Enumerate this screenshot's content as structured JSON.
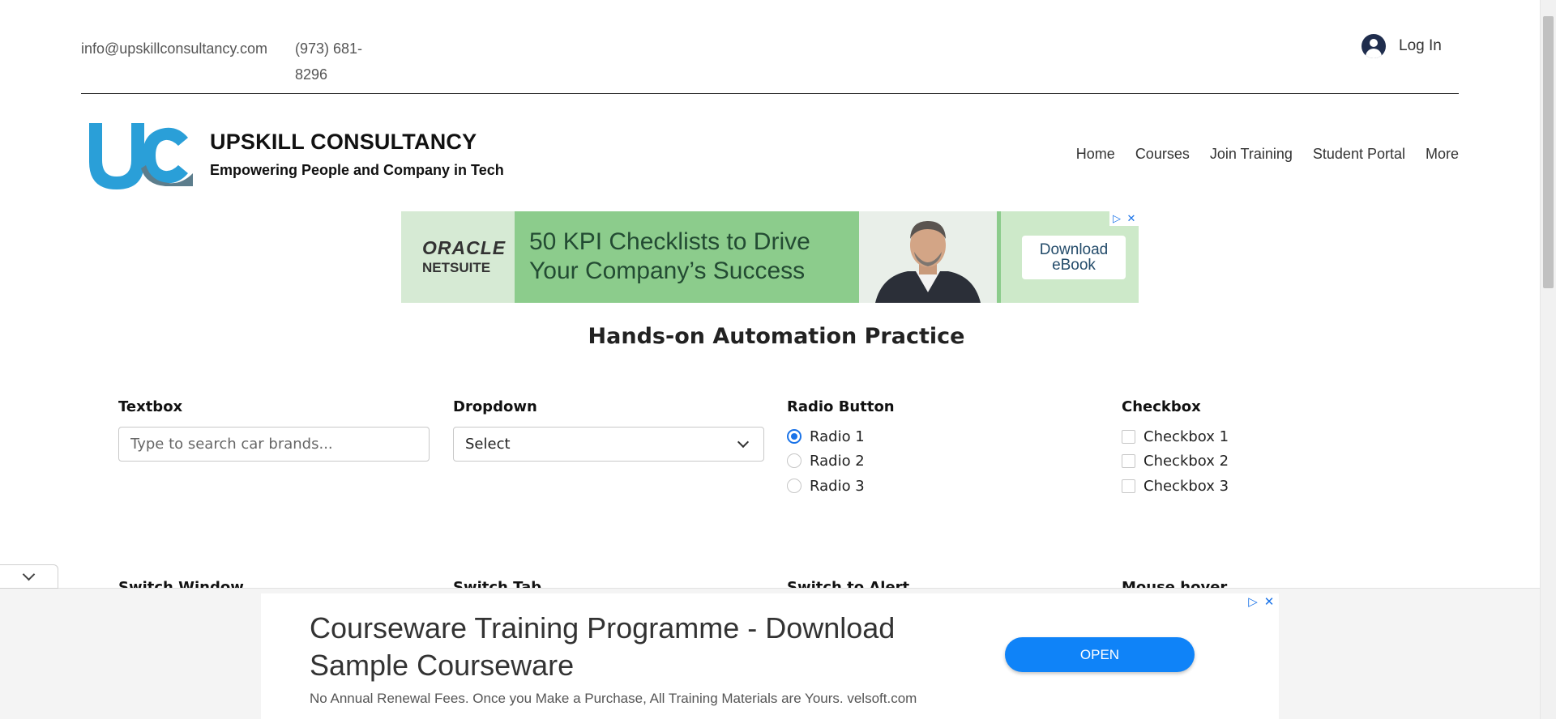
{
  "contact": {
    "email": "info@upskillconsultancy.com",
    "phone": "(973) 681-8296"
  },
  "login": {
    "label": "Log In"
  },
  "brand": {
    "name": "UPSKILL CONSULTANCY",
    "tagline": "Empowering People and Company in Tech",
    "logo_colors": [
      "#2a9fd8",
      "#5c7d8c"
    ]
  },
  "nav": {
    "items": [
      {
        "label": "Home"
      },
      {
        "label": "Courses"
      },
      {
        "label": "Join Training"
      },
      {
        "label": "Student Portal"
      },
      {
        "label": "More"
      }
    ]
  },
  "ad_banner": {
    "brand_line1": "ORACLE",
    "brand_line2": "NETSUITE",
    "headline": "50 KPI Checklists to Drive Your Company’s Success",
    "cta": "Download eBook",
    "controls": [
      "ad-choices-icon",
      "close-icon"
    ]
  },
  "practice": {
    "title": "Hands-on Automation Practice",
    "textbox": {
      "label": "Textbox",
      "placeholder": "Type to search car brands..."
    },
    "dropdown": {
      "label": "Dropdown",
      "selected": "Select"
    },
    "radio": {
      "label": "Radio Button",
      "options": [
        {
          "label": "Radio 1",
          "checked": true
        },
        {
          "label": "Radio 2",
          "checked": false
        },
        {
          "label": "Radio 3",
          "checked": false
        }
      ]
    },
    "checkbox": {
      "label": "Checkbox",
      "options": [
        {
          "label": "Checkbox 1",
          "checked": false
        },
        {
          "label": "Checkbox 2",
          "checked": false
        },
        {
          "label": "Checkbox 3",
          "checked": false
        }
      ]
    },
    "row2_labels": [
      "Switch Window",
      "Switch Tab",
      "Switch to Alert",
      "Mouse hover"
    ]
  },
  "sticky_ad": {
    "title": "Courseware Training Programme - Download Sample Courseware",
    "description": "No Annual Renewal Fees. Once you Make a Purchase, All Training Materials are Yours. velsoft.com",
    "cta": "OPEN"
  },
  "colors": {
    "accent": "#1a73e8",
    "open_button": "#0f83f8",
    "ad_green": "#8ccc8c"
  }
}
